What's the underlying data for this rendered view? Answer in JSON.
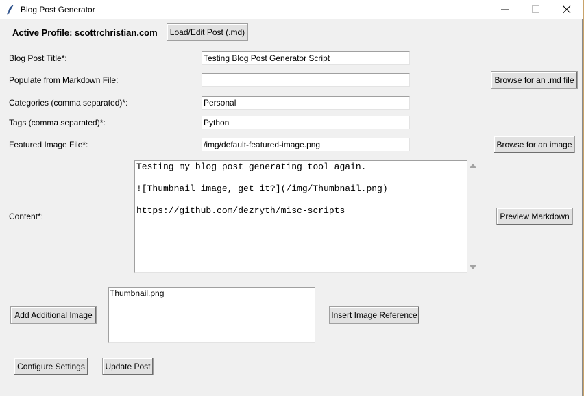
{
  "window": {
    "title": "Blog Post Generator"
  },
  "header": {
    "profile": "Active Profile: scottrchristian.com",
    "load_button": "Load/Edit Post (.md)"
  },
  "form": {
    "title_label": "Blog Post Title*:",
    "title_value": "Testing Blog Post Generator Script",
    "md_label": "Populate from Markdown File:",
    "md_value": "",
    "md_browse": "Browse for an .md file",
    "categories_label": "Categories (comma separated)*:",
    "categories_value": "Personal",
    "tags_label": "Tags (comma separated)*:",
    "tags_value": "Python",
    "image_label": "Featured Image File*:",
    "image_value": "/img/default-featured-image.png",
    "image_browse": "Browse for an image",
    "content_label": "Content*:",
    "content_lines": [
      "Testing my blog post generating tool again.",
      "",
      "![Thumbnail image, get it?](/img/Thumbnail.png)",
      "",
      "https://github.com/dezryth/misc-scripts"
    ],
    "preview_button": "Preview Markdown"
  },
  "images": {
    "add_button": "Add Additional Image",
    "items": [
      "Thumbnail.png"
    ],
    "insert_button": "Insert Image Reference"
  },
  "footer": {
    "settings_button": "Configure Settings",
    "update_button": "Update Post"
  },
  "icons": {
    "app": "feather-icon",
    "minimize": "minimize-icon",
    "maximize": "maximize-icon",
    "close": "close-icon"
  }
}
